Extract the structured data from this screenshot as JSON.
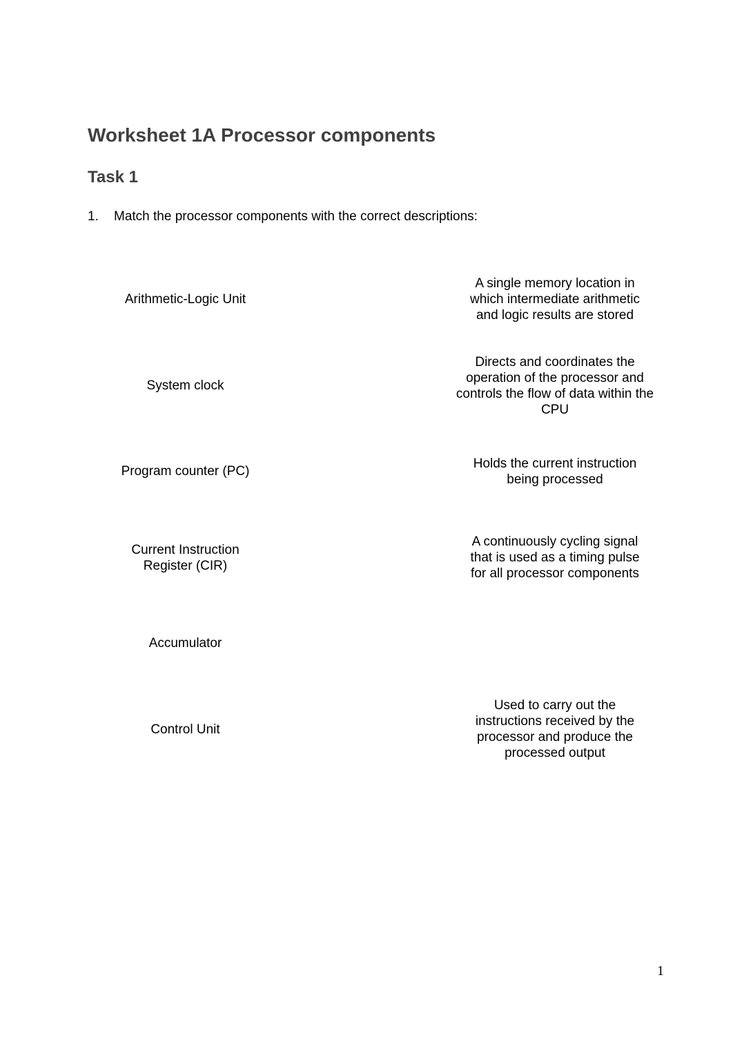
{
  "document": {
    "title": "Worksheet 1A Processor components",
    "task_heading": "Task 1",
    "question": {
      "number": "1.",
      "text": "Match the processor components with the correct descriptions:"
    },
    "components": [
      "Arithmetic-Logic Unit",
      "System clock",
      "Program counter (PC)",
      "Current Instruction Register (CIR)",
      "Accumulator",
      "Control Unit"
    ],
    "descriptions": [
      "A single memory location in which intermediate arithmetic and logic results are stored",
      "Directs and coordinates the operation of the processor and controls the flow of data within the CPU",
      "Holds the current instruction being processed",
      "A continuously cycling signal that is used as a timing pulse for all processor components",
      "",
      "Used to carry out the instructions received by the processor and produce the processed output"
    ],
    "page_number": "1"
  }
}
